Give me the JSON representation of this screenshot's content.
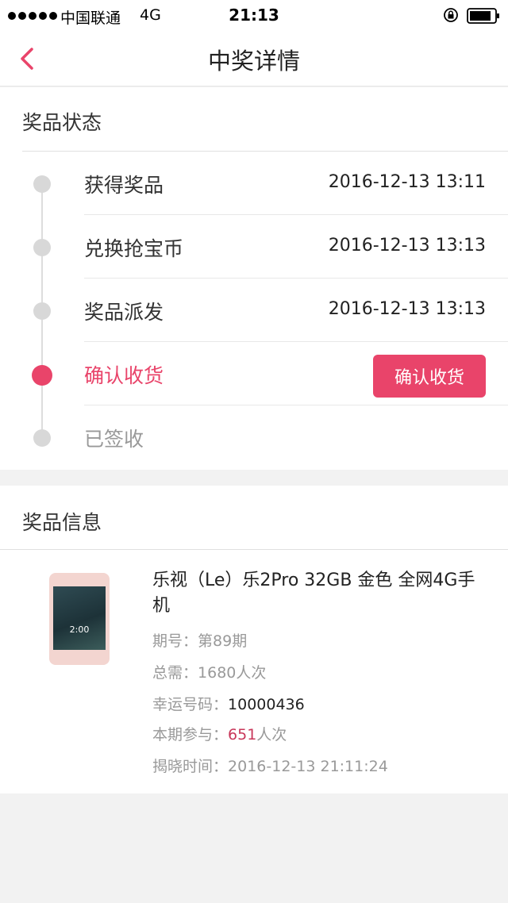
{
  "status_bar": {
    "carrier": "中国联通",
    "network": "4G",
    "time": "21:13"
  },
  "nav": {
    "title": "中奖详情"
  },
  "prize_status": {
    "title": "奖品状态",
    "steps": [
      {
        "label": "获得奖品",
        "time": "2016-12-13 13:11"
      },
      {
        "label": "兑换抢宝币",
        "time": "2016-12-13 13:13"
      },
      {
        "label": "奖品派发",
        "time": "2016-12-13 13:13"
      },
      {
        "label": "确认收货",
        "button": "确认收货"
      },
      {
        "label": "已签收"
      }
    ]
  },
  "prize_info": {
    "title": "奖品信息",
    "product_name": "乐视（Le）乐2Pro 32GB 金色 全网4G手机",
    "product_image_clock": "2:00",
    "period_label": "期号：",
    "period_value": "第89期",
    "total_label": "总需：",
    "total_value": "1680人次",
    "lucky_label": "幸运号码：",
    "lucky_value": "10000436",
    "participate_label": "本期参与：",
    "participate_count": "651",
    "participate_unit": "人次",
    "reveal_label": "揭晓时间：",
    "reveal_value": "2016-12-13 21:11:24"
  },
  "colors": {
    "accent": "#e9446a",
    "highlight": "#c8375a"
  }
}
